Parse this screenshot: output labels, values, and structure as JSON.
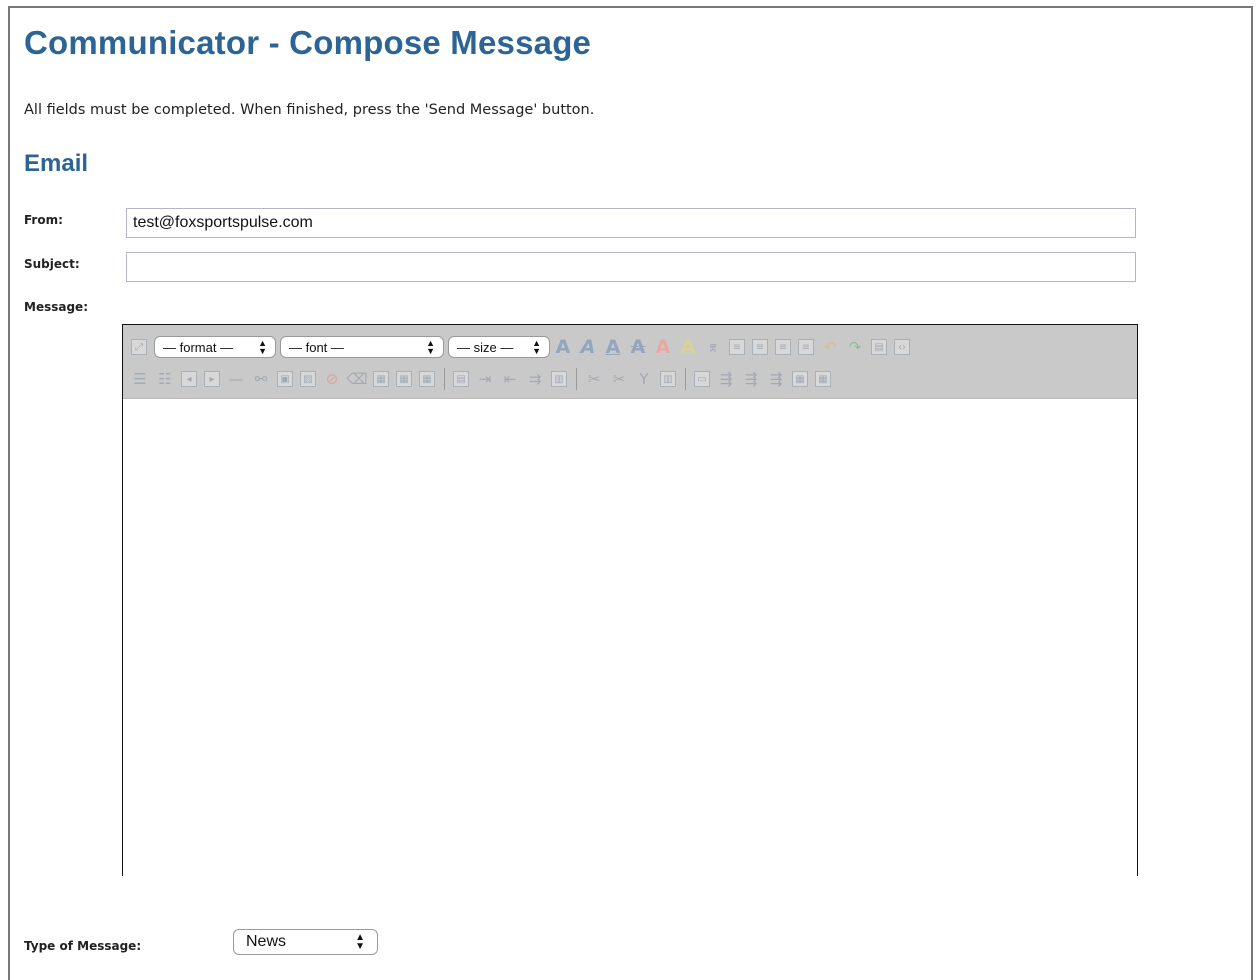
{
  "page": {
    "title": "Communicator - Compose Message",
    "instructions": "All fields must be completed. When finished, press the 'Send Message' button.",
    "section_title": "Email"
  },
  "form": {
    "from_label": "From:",
    "from_value": "test@foxsportspulse.com",
    "subject_label": "Subject:",
    "subject_value": "",
    "message_label": "Message:",
    "type_label": "Type of Message:",
    "type_value": "News"
  },
  "editor": {
    "format_select": "— format —",
    "font_select": "— font —",
    "size_select": "— size —",
    "toolbar_row1_icons": [
      "fullscreen-icon",
      "font-size-up-icon",
      "font-italic-a-icon",
      "font-underline-a-icon",
      "strikethrough-a-icon",
      "text-color-icon",
      "highlight-color-icon",
      "remove-format-icon",
      "align-left-icon",
      "align-center-icon",
      "align-right-icon",
      "align-justify-icon",
      "undo-icon",
      "redo-icon",
      "print-icon",
      "source-code-icon"
    ],
    "toolbar_row2_icons": [
      "numbered-list-icon",
      "bullet-list-icon",
      "outdent-icon",
      "indent-icon",
      "horizontal-rule-icon",
      "link-icon",
      "image-icon",
      "insert-media-icon",
      "unlink-icon",
      "eraser-icon",
      "table-icon",
      "table-props-icon",
      "cell-props-icon",
      "row-props-icon",
      "insert-row-before-icon",
      "insert-row-after-icon",
      "delete-row-icon",
      "split-cells-icon",
      "merge-cells-icon",
      "cut-icon",
      "copy-icon",
      "paste-icon",
      "col-props-icon",
      "insert-col-before-icon",
      "insert-col-after-icon",
      "delete-col-icon",
      "table-merge-icon",
      "table-delete-icon"
    ]
  }
}
